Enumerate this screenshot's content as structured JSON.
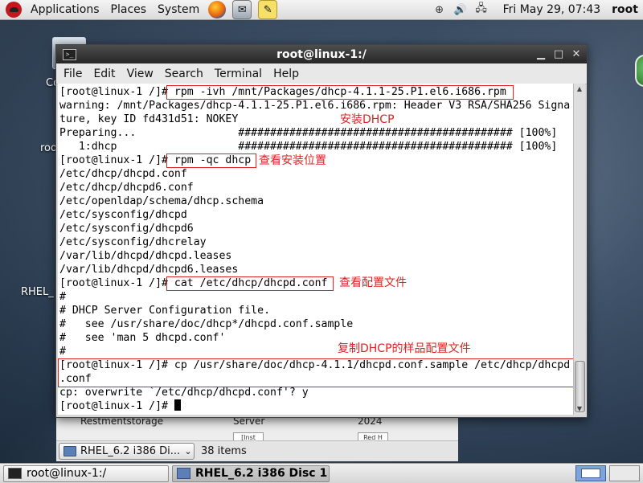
{
  "top_panel": {
    "menus": [
      "Applications",
      "Places",
      "System"
    ],
    "launcher_icons": [
      "firefox-icon",
      "mail-icon",
      "notes-icon"
    ],
    "tray_icons": [
      "accessibility-icon",
      "volume-icon",
      "network-icon"
    ],
    "clock": "Fri May 29, 07:43",
    "user": "root"
  },
  "desktop": {
    "icon_labels": [
      "Co",
      "roo",
      "RHEL_"
    ]
  },
  "terminal": {
    "title": "root@linux-1:/",
    "menu": [
      "File",
      "Edit",
      "View",
      "Search",
      "Terminal",
      "Help"
    ],
    "lines": [
      "[root@linux-1 /]# rpm -ivh /mnt/Packages/dhcp-4.1.1-25.P1.el6.i686.rpm",
      "warning: /mnt/Packages/dhcp-4.1.1-25.P1.el6.i686.rpm: Header V3 RSA/SHA256 Signa",
      "ture, key ID fd431d51: NOKEY",
      "Preparing...                ########################################### [100%]",
      "   1:dhcp                   ########################################### [100%]",
      "[root@linux-1 /]# rpm -qc dhcp",
      "/etc/dhcp/dhcpd.conf",
      "/etc/dhcp/dhcpd6.conf",
      "/etc/openldap/schema/dhcp.schema",
      "/etc/sysconfig/dhcpd",
      "/etc/sysconfig/dhcpd6",
      "/etc/sysconfig/dhcrelay",
      "/var/lib/dhcpd/dhcpd.leases",
      "/var/lib/dhcpd/dhcpd6.leases",
      "[root@linux-1 /]# cat /etc/dhcp/dhcpd.conf",
      "#",
      "# DHCP Server Configuration file.",
      "#   see /usr/share/doc/dhcp*/dhcpd.conf.sample",
      "#   see 'man 5 dhcpd.conf'",
      "#",
      "[root@linux-1 /]# cp /usr/share/doc/dhcp-4.1.1/dhcpd.conf.sample /etc/dhcp/dhcpd",
      ".conf",
      "cp: overwrite `/etc/dhcp/dhcpd.conf'? y",
      "[root@linux-1 /]# "
    ],
    "annotations": [
      "安装DHCP",
      "查看安装位置",
      "查看配置文件",
      "复制DHCP的样品配置文件"
    ]
  },
  "file_manager": {
    "location": "RHEL_6.2 i386 Di...",
    "item_count": "38 items",
    "partial_labels": [
      "Restmentstorage",
      "Server",
      "2024"
    ],
    "chips": [
      "[Inst",
      "Red H"
    ]
  },
  "taskbar": {
    "tasks": [
      "root@linux-1:/",
      "RHEL_6.2 i386 Disc 1"
    ],
    "workspace_count": 2,
    "active_workspace": 1
  },
  "colors": {
    "annotation": "#dd2222",
    "titlebar": "#333333"
  }
}
